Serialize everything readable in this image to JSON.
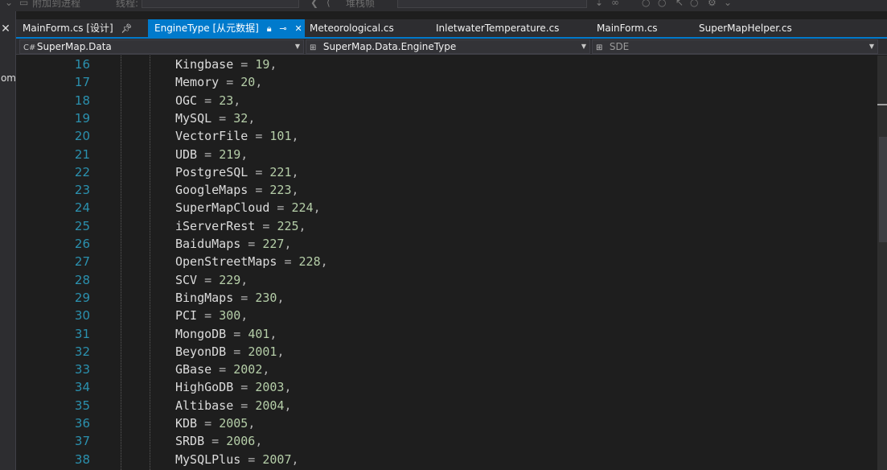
{
  "toolbar": {
    "left_text": "附加到进程",
    "thread_label": "线程:",
    "right_text": "堆栈帧"
  },
  "left_panel": {
    "cut_text": "om"
  },
  "tabs": [
    {
      "label": "MainForm.cs [设计]",
      "active": false,
      "pinned": true
    },
    {
      "label": "EngineType [从元数据]",
      "active": true,
      "pinned": true
    },
    {
      "label": "Meteorological.cs",
      "active": false
    },
    {
      "label": "InletwaterTemperature.cs",
      "active": false
    },
    {
      "label": "MainForm.cs",
      "active": false
    },
    {
      "label": "SuperMapHelper.cs",
      "active": false
    }
  ],
  "navbar": {
    "project": "SuperMap.Data",
    "type": "SuperMap.Data.EngineType",
    "member": "SDE"
  },
  "code_lines": [
    {
      "n": "16",
      "name": "Kingbase",
      "value": "19"
    },
    {
      "n": "17",
      "name": "Memory",
      "value": "20"
    },
    {
      "n": "18",
      "name": "OGC",
      "value": "23"
    },
    {
      "n": "19",
      "name": "MySQL",
      "value": "32"
    },
    {
      "n": "20",
      "name": "VectorFile",
      "value": "101"
    },
    {
      "n": "21",
      "name": "UDB",
      "value": "219"
    },
    {
      "n": "22",
      "name": "PostgreSQL",
      "value": "221"
    },
    {
      "n": "23",
      "name": "GoogleMaps",
      "value": "223"
    },
    {
      "n": "24",
      "name": "SuperMapCloud",
      "value": "224"
    },
    {
      "n": "25",
      "name": "iServerRest",
      "value": "225"
    },
    {
      "n": "26",
      "name": "BaiduMaps",
      "value": "227"
    },
    {
      "n": "27",
      "name": "OpenStreetMaps",
      "value": "228"
    },
    {
      "n": "28",
      "name": "SCV",
      "value": "229"
    },
    {
      "n": "29",
      "name": "BingMaps",
      "value": "230"
    },
    {
      "n": "30",
      "name": "PCI",
      "value": "300"
    },
    {
      "n": "31",
      "name": "MongoDB",
      "value": "401"
    },
    {
      "n": "32",
      "name": "BeyonDB",
      "value": "2001"
    },
    {
      "n": "33",
      "name": "GBase",
      "value": "2002"
    },
    {
      "n": "34",
      "name": "HighGoDB",
      "value": "2003"
    },
    {
      "n": "35",
      "name": "Altibase",
      "value": "2004"
    },
    {
      "n": "36",
      "name": "KDB",
      "value": "2005"
    },
    {
      "n": "37",
      "name": "SRDB",
      "value": "2006"
    },
    {
      "n": "38",
      "name": "MySQLPlus",
      "value": "2007"
    }
  ],
  "colors": {
    "accent": "#007acc",
    "line_number": "#2b91af",
    "number_literal": "#b5cea8",
    "identifier": "#dcdcdc"
  }
}
